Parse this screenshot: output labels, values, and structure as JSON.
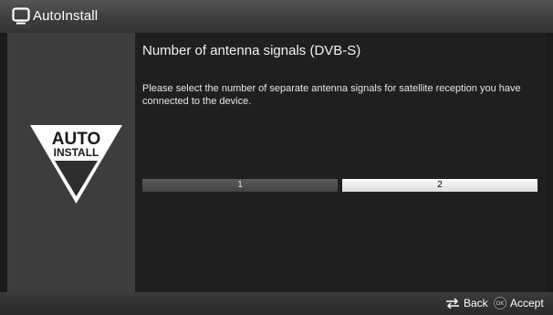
{
  "window": {
    "title": "AutoInstall",
    "icon": "tv-icon"
  },
  "sidebar": {
    "logo_line1": "AUTO",
    "logo_line2": "INSTALL"
  },
  "main": {
    "heading": "Number of antenna signals (DVB-S)",
    "description": "Please select the number of separate antenna signals for satellite reception you have connected to the device.",
    "options": [
      {
        "label": "1",
        "selected": false
      },
      {
        "label": "2",
        "selected": true
      }
    ]
  },
  "footer": {
    "back_label": "Back",
    "back_icon": "back-arrows-icon",
    "ok_badge": "OK",
    "accept_label": "Accept"
  },
  "colors": {
    "background": "#1a1a1a",
    "sidebar": "#3d3d3d",
    "selected_option": "#f0f0f0",
    "unselected_option": "#4e4e4e"
  }
}
